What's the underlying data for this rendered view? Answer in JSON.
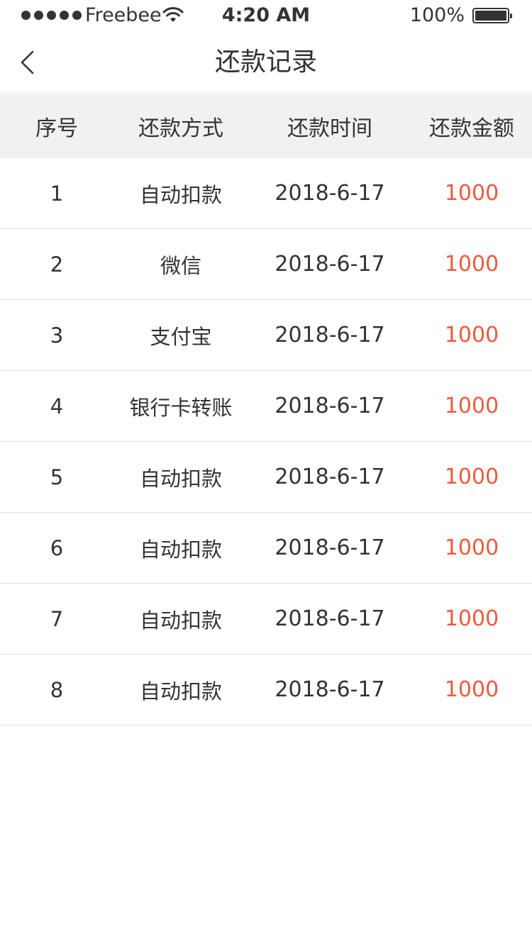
{
  "status_bar": {
    "carrier": "Freebee",
    "time": "4:20 AM",
    "battery": "100%"
  },
  "nav": {
    "title": "还款记录",
    "back_icon": "chevron-left-icon"
  },
  "table": {
    "headers": [
      "序号",
      "还款方式",
      "还款时间",
      "还款金额"
    ],
    "rows": [
      {
        "index": "1",
        "method": "自动扣款",
        "date": "2018-6-17",
        "amount": "1000"
      },
      {
        "index": "2",
        "method": "微信",
        "date": "2018-6-17",
        "amount": "1000"
      },
      {
        "index": "3",
        "method": "支付宝",
        "date": "2018-6-17",
        "amount": "1000"
      },
      {
        "index": "4",
        "method": "银行卡转账",
        "date": "2018-6-17",
        "amount": "1000"
      },
      {
        "index": "5",
        "method": "自动扣款",
        "date": "2018-6-17",
        "amount": "1000"
      },
      {
        "index": "6",
        "method": "自动扣款",
        "date": "2018-6-17",
        "amount": "1000"
      },
      {
        "index": "7",
        "method": "自动扣款",
        "date": "2018-6-17",
        "amount": "1000"
      },
      {
        "index": "8",
        "method": "自动扣款",
        "date": "2018-6-17",
        "amount": "1000"
      }
    ]
  },
  "colors": {
    "amount": "#ee5a3c",
    "header_bg": "#f2f0f0",
    "text": "#333333"
  }
}
